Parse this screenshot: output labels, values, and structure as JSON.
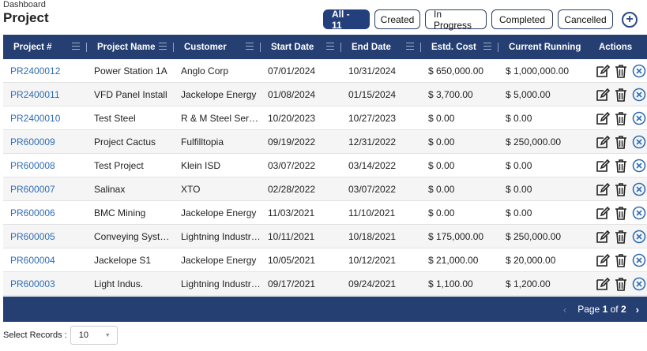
{
  "breadcrumb": "Dashboard",
  "title": "Project",
  "filters": [
    "All - 11",
    "Created",
    "In Progress",
    "Completed",
    "Cancelled"
  ],
  "add_button": "+",
  "columns": [
    "Project #",
    "Project Name",
    "Customer",
    "Start Date",
    "End Date",
    "Estd. Cost",
    "Current Running",
    "Actions"
  ],
  "rows": [
    [
      "PR2400012",
      "Power Station 1A",
      "Anglo Corp",
      "07/01/2024",
      "10/31/2024",
      "$ 650,000.00",
      "$ 1,000,000.00"
    ],
    [
      "PR2400011",
      "VFD Panel Install",
      "Jackelope Energy",
      "01/08/2024",
      "01/15/2024",
      "$ 3,700.00",
      "$ 5,000.00"
    ],
    [
      "PR2400010",
      "Test Steel",
      "R & M Steel Services",
      "10/20/2023",
      "10/27/2023",
      "$ 0.00",
      "$ 0.00"
    ],
    [
      "PR600009",
      "Project Cactus",
      "Fulfilltopia",
      "09/19/2022",
      "12/31/2022",
      "$ 0.00",
      "$ 250,000.00"
    ],
    [
      "PR600008",
      "Test Project",
      "Klein ISD",
      "03/07/2022",
      "03/14/2022",
      "$ 0.00",
      "$ 0.00"
    ],
    [
      "PR600007",
      "Salinax",
      "XTO",
      "02/28/2022",
      "03/07/2022",
      "$ 0.00",
      "$ 0.00"
    ],
    [
      "PR600006",
      "BMC Mining",
      "Jackelope Energy",
      "11/03/2021",
      "11/10/2021",
      "$ 0.00",
      "$ 0.00"
    ],
    [
      "PR600005",
      "Conveying Systems",
      "Lightning Industries",
      "10/11/2021",
      "10/18/2021",
      "$ 175,000.00",
      "$ 250,000.00"
    ],
    [
      "PR600004",
      "Jackelope S1",
      "Jackelope Energy",
      "10/05/2021",
      "10/12/2021",
      "$ 21,000.00",
      "$ 20,000.00"
    ],
    [
      "PR600003",
      "Light Indus.",
      "Lightning Industries",
      "09/17/2021",
      "09/24/2021",
      "$ 1,100.00",
      "$ 1,200.00"
    ]
  ],
  "pagination": {
    "prefix": "Page",
    "current": "1",
    "of": "of",
    "total": "2",
    "prev": "‹",
    "next": "›"
  },
  "select_records": {
    "label": "Select Records :",
    "value": "10",
    "caret": "▼"
  },
  "colors": {
    "header": "#263f73",
    "link": "#2f6db5",
    "active_filter": "#23407c"
  }
}
